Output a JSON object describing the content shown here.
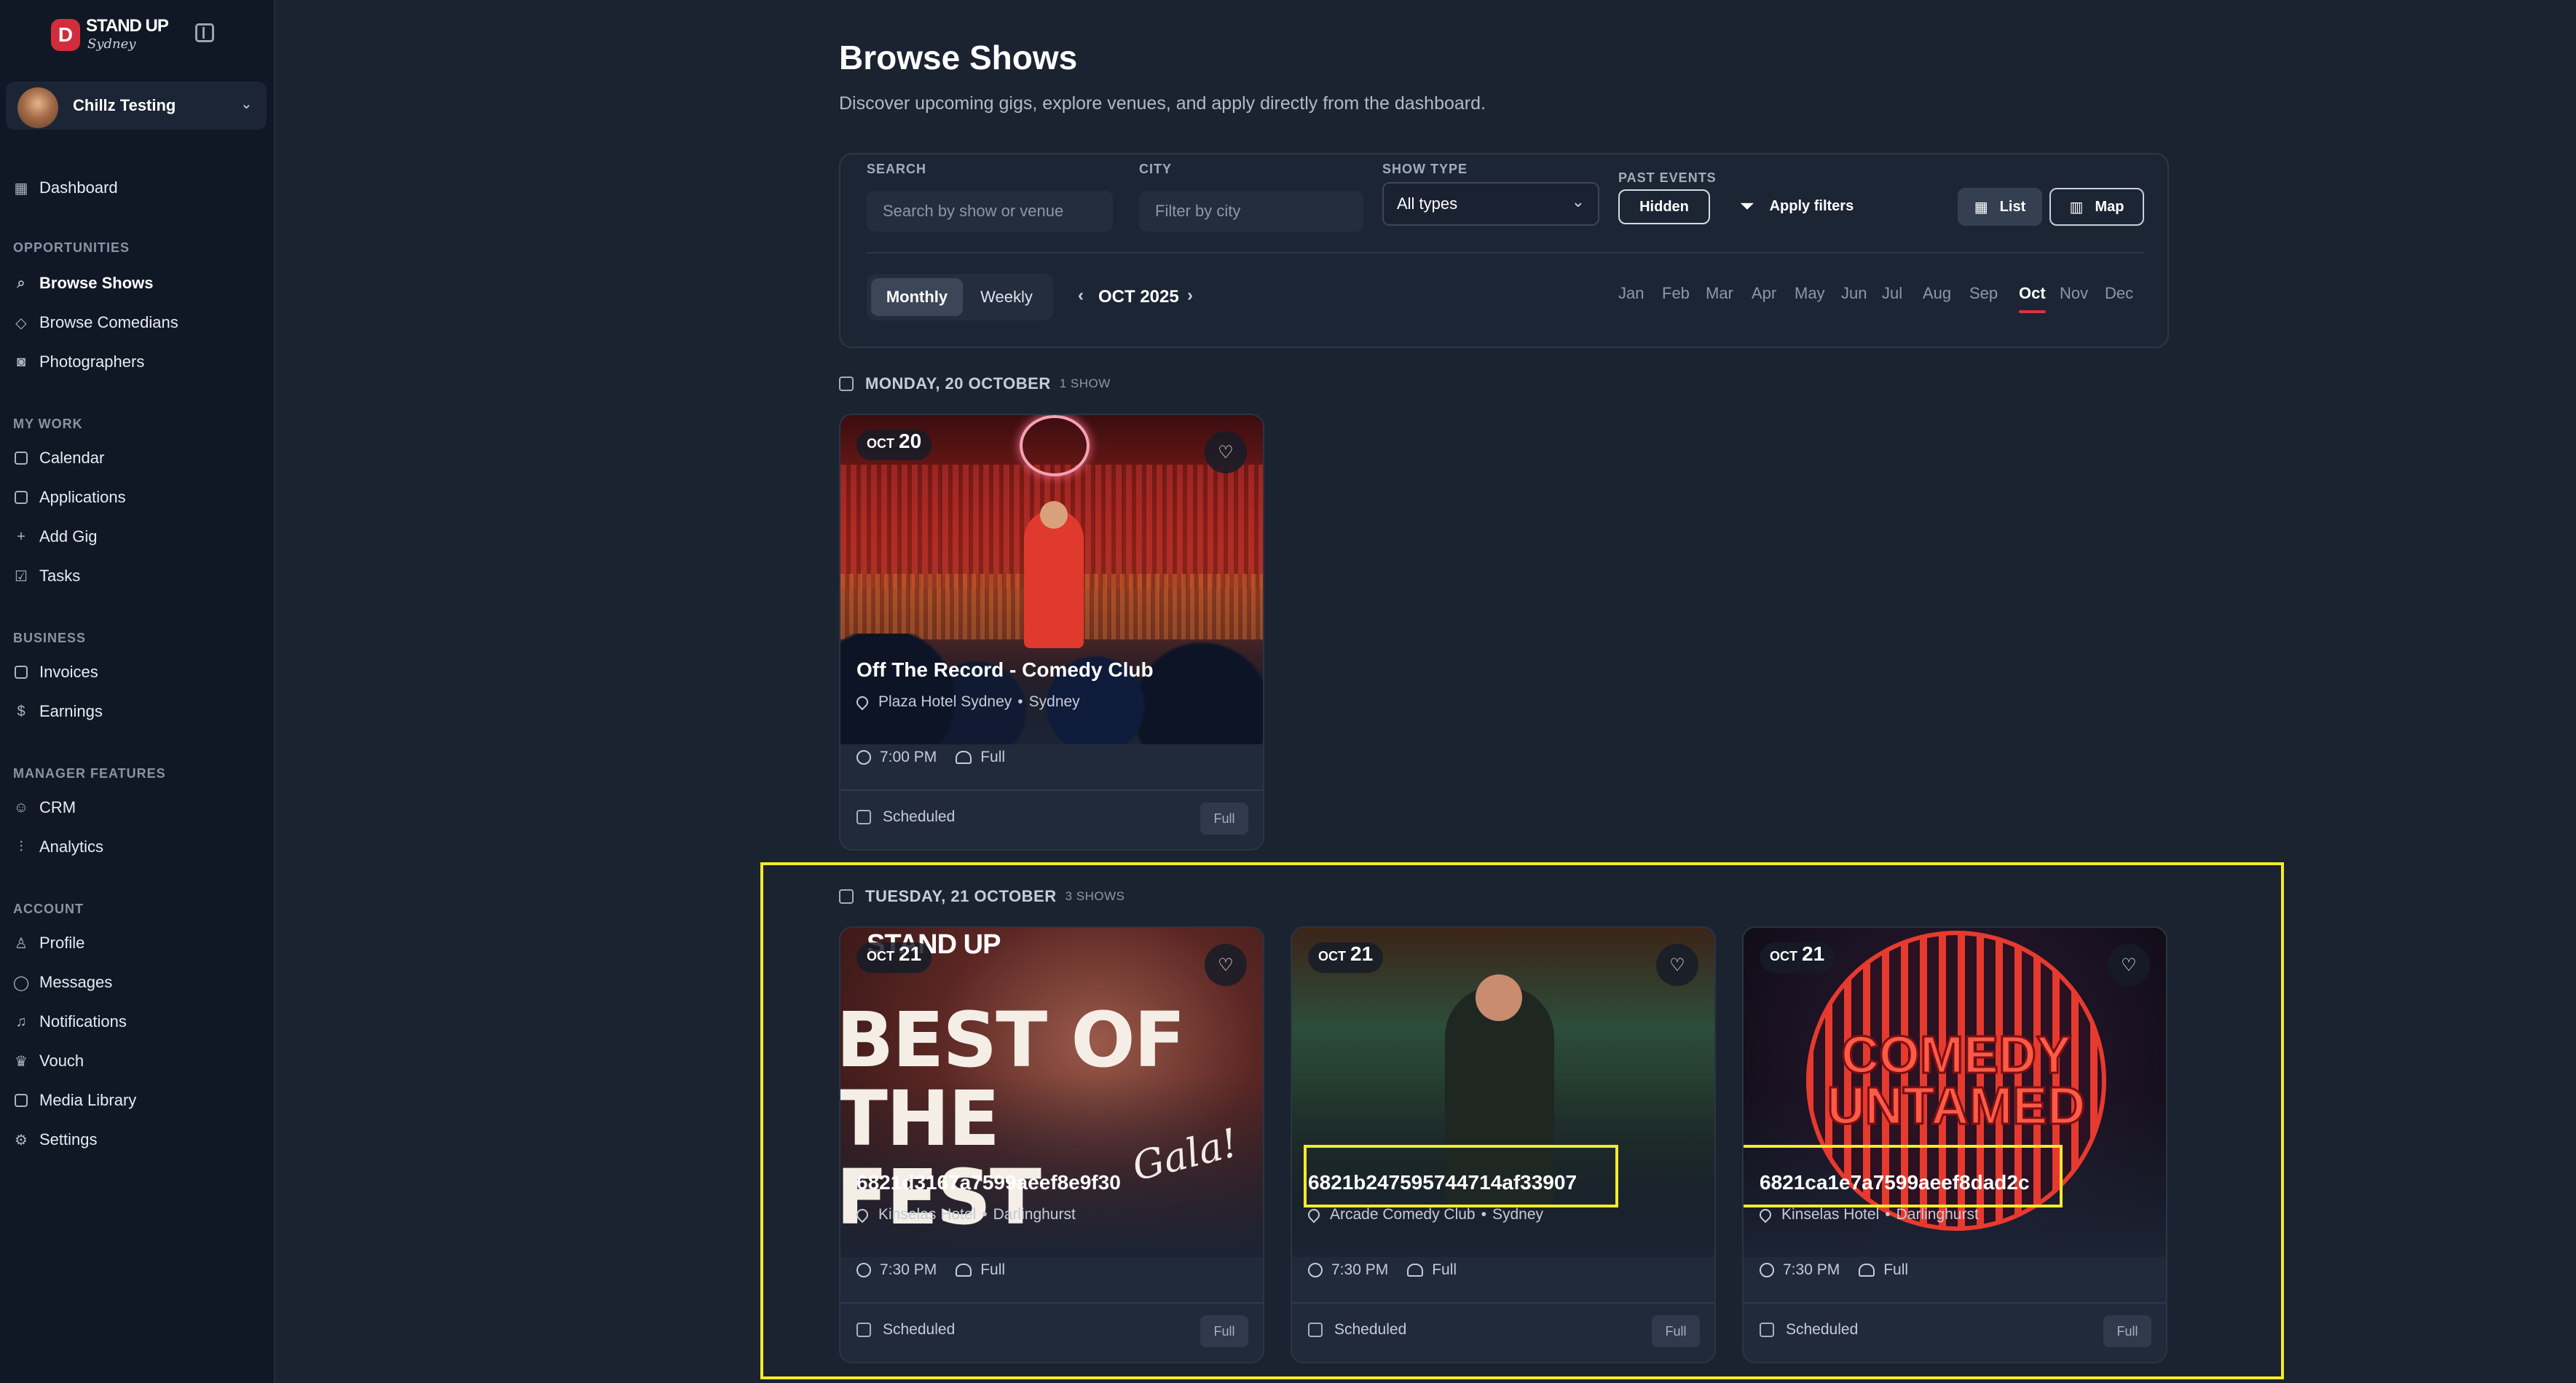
{
  "brand": {
    "logo_letter": "D",
    "name": "STAND UP",
    "sub": "Sydney"
  },
  "user": {
    "name": "Chillz Testing"
  },
  "nav": {
    "dashboard": "Dashboard",
    "sections": {
      "opportunities": "OPPORTUNITIES",
      "my_work": "MY WORK",
      "business": "BUSINESS",
      "manager": "MANAGER FEATURES",
      "account": "ACCOUNT"
    },
    "browse_shows": "Browse Shows",
    "browse_comedians": "Browse Comedians",
    "photographers": "Photographers",
    "calendar": "Calendar",
    "applications": "Applications",
    "add_gig": "Add Gig",
    "tasks": "Tasks",
    "invoices": "Invoices",
    "earnings": "Earnings",
    "crm": "CRM",
    "analytics": "Analytics",
    "profile": "Profile",
    "messages": "Messages",
    "notifications": "Notifications",
    "vouch": "Vouch",
    "media_library": "Media Library",
    "settings": "Settings"
  },
  "page": {
    "title": "Browse Shows",
    "subtitle": "Discover upcoming gigs, explore venues, and apply directly from the dashboard."
  },
  "filters": {
    "search_label": "SEARCH",
    "search_placeholder": "Search by show or venue",
    "city_label": "CITY",
    "city_placeholder": "Filter by city",
    "type_label": "SHOW TYPE",
    "type_value": "All types",
    "past_label": "PAST EVENTS",
    "past_value": "Hidden",
    "apply": "Apply filters",
    "list": "List",
    "map": "Map",
    "monthly": "Monthly",
    "weekly": "Weekly",
    "current_month": "OCT 2025",
    "months": [
      "Jan",
      "Feb",
      "Mar",
      "Apr",
      "May",
      "Jun",
      "Jul",
      "Aug",
      "Sep",
      "Oct",
      "Nov",
      "Dec"
    ],
    "selected_month": "Oct"
  },
  "days": [
    {
      "heading": "MONDAY, 20 OCTOBER",
      "count": "1 SHOW",
      "shows": [
        {
          "month": "OCT",
          "day": "20",
          "name": "Off The Record - Comedy Club",
          "venue": "Plaza Hotel Sydney",
          "city": "Sydney",
          "time": "7:00 PM",
          "capacity": "Full",
          "status": "Scheduled",
          "chip": "Full"
        }
      ]
    },
    {
      "heading": "TUESDAY, 21 OCTOBER",
      "count": "3 SHOWS",
      "shows": [
        {
          "month": "OCT",
          "day": "21",
          "name": "6821d3167a7599aeef8e9f30",
          "venue": "Kinselas Hotel",
          "city": "Darlinghurst",
          "time": "7:30 PM",
          "capacity": "Full",
          "status": "Scheduled",
          "chip": "Full",
          "poster_brand": "STAND UP",
          "poster_title": "BEST OF THE FEST",
          "poster_script": "Gala!"
        },
        {
          "month": "OCT",
          "day": "21",
          "name": "6821b247595744714af33907",
          "venue": "Arcade Comedy Club",
          "city": "Sydney",
          "time": "7:30 PM",
          "capacity": "Full",
          "status": "Scheduled",
          "chip": "Full"
        },
        {
          "month": "OCT",
          "day": "21",
          "name": "6821ca1e7a7599aeef8dad2c",
          "venue": "Kinselas Hotel",
          "city": "Darlinghurst",
          "time": "7:30 PM",
          "capacity": "Full",
          "status": "Scheduled",
          "chip": "Full",
          "poster_title": "COMEDY UNTAMED"
        }
      ]
    }
  ],
  "colors": {
    "accent": "#e0323f",
    "highlight": "#f5ea2a",
    "bg": "#1b2331",
    "sidebar": "#101826"
  }
}
